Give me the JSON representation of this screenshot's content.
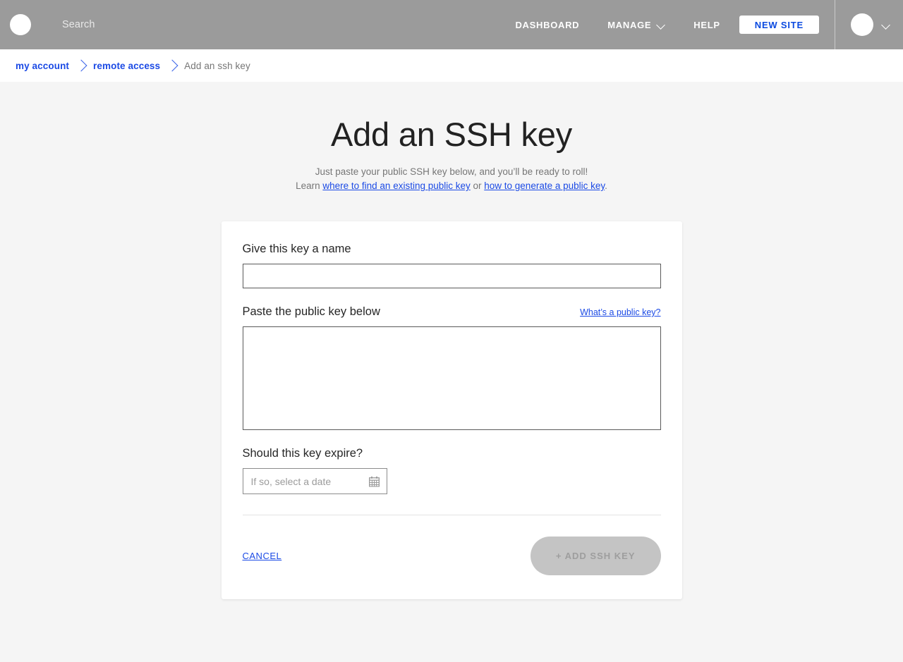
{
  "navbar": {
    "logo_icon": "circle-logo-icon",
    "search_label": "Search",
    "links": [
      {
        "label": "DASHBOARD",
        "has_chevron": false
      },
      {
        "label": "MANAGE",
        "has_chevron": true
      },
      {
        "label": "HELP",
        "has_chevron": false
      }
    ],
    "new_site_label": "NEW SITE",
    "avatar_icon": "user-avatar-icon",
    "account_chevron_icon": "chevron-down-icon",
    "background_color": "#9b9b9b",
    "accent_color": "#0b4ae0"
  },
  "breadcrumb": {
    "items": [
      {
        "label": "my account",
        "is_link": true
      },
      {
        "label": "remote access",
        "is_link": true
      },
      {
        "label": "Add an ssh key",
        "is_link": false
      }
    ],
    "separator_icon": "chevron-right-icon",
    "link_color": "#1b4ae5"
  },
  "page": {
    "title": "Add an SSH key",
    "subtitle_line1": "Just paste your public SSH key below, and you’ll be ready to roll!",
    "subtitle_learn_prefix": "Learn ",
    "subtitle_link1": "where to find an existing public key",
    "subtitle_or": " or ",
    "subtitle_link2": "how to generate a public key",
    "subtitle_period": ".",
    "background_color": "#f5f5f5"
  },
  "form": {
    "name_label": "Give this key a name",
    "name_value": "",
    "name_placeholder": "",
    "key_label": "Paste the public key below",
    "key_help_link": "What’s a public key?",
    "key_value": "",
    "key_placeholder": "",
    "expire_label": "Should this key expire?",
    "expire_value": "",
    "expire_placeholder": "If so, select a date",
    "calendar_icon": "calendar-icon",
    "cancel_label": "CANCEL",
    "submit_label": "+ ADD SSH KEY",
    "submit_disabled": true,
    "submit_bg_color": "#c4c4c4",
    "submit_text_color": "#9e9e9e"
  }
}
